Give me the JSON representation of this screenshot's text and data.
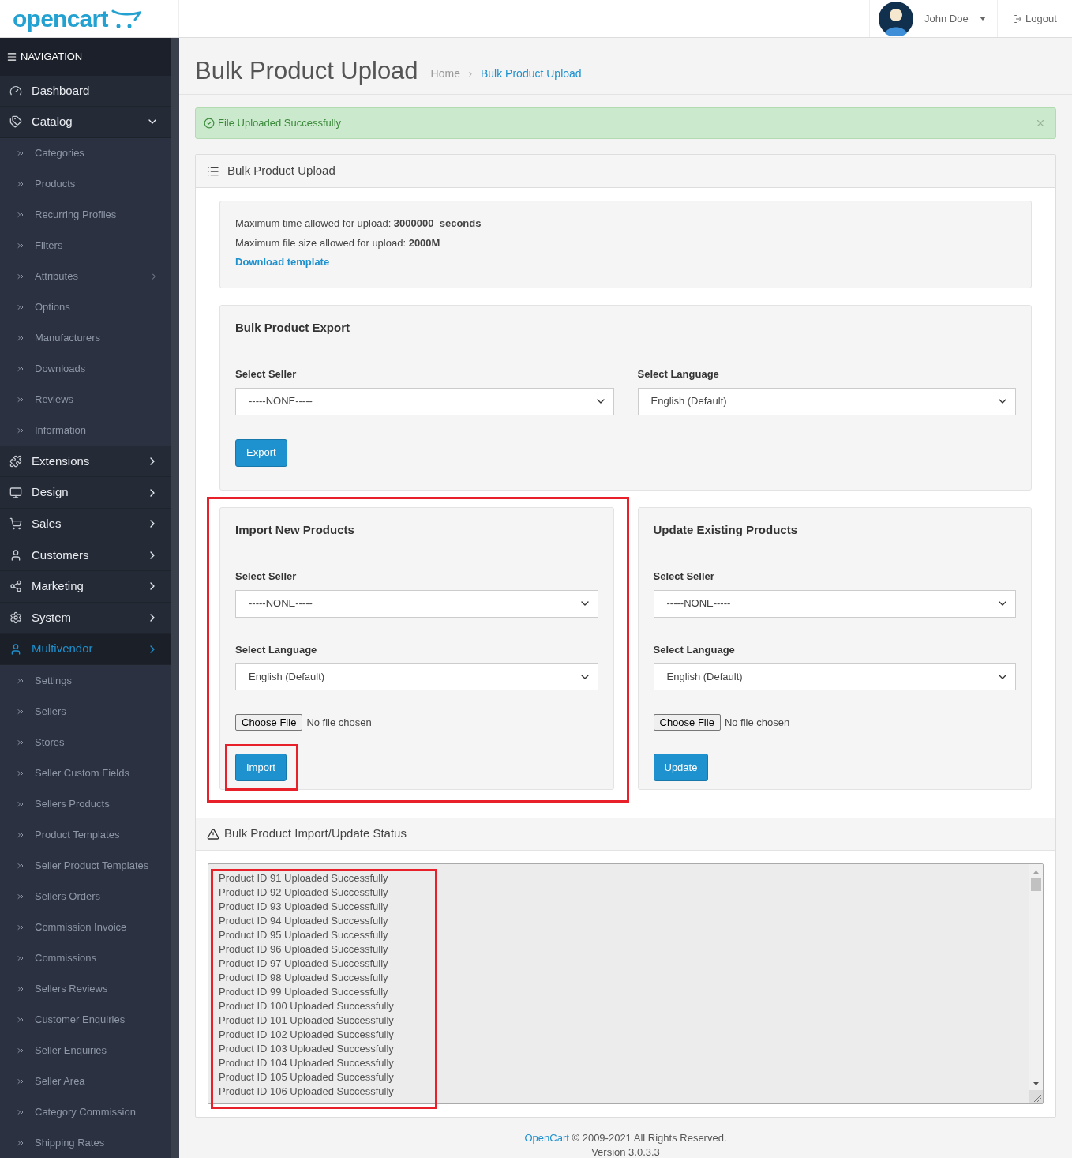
{
  "header": {
    "logo": "opencart",
    "user_name": "John Doe",
    "logout": "Logout"
  },
  "sidebar": {
    "title": "NAVIGATION",
    "items": [
      {
        "label": "Dashboard",
        "kind": "link",
        "selected": false
      },
      {
        "label": "Catalog",
        "kind": "menu_open",
        "selected": false,
        "expanded": true,
        "children": [
          {
            "label": "Categories",
            "kind": "link"
          },
          {
            "label": "Products",
            "kind": "link"
          },
          {
            "label": "Recurring Profiles",
            "kind": "link"
          },
          {
            "label": "Filters",
            "kind": "link"
          },
          {
            "label": "Attributes",
            "kind": "menu"
          },
          {
            "label": "Options",
            "kind": "link"
          },
          {
            "label": "Manufacturers",
            "kind": "link"
          },
          {
            "label": "Downloads",
            "kind": "link"
          },
          {
            "label": "Reviews",
            "kind": "link"
          },
          {
            "label": "Information",
            "kind": "link"
          }
        ]
      },
      {
        "label": "Extensions",
        "kind": "menu",
        "selected": false
      },
      {
        "label": "Design",
        "kind": "menu",
        "selected": false
      },
      {
        "label": "Sales",
        "kind": "menu",
        "selected": false
      },
      {
        "label": "Customers",
        "kind": "menu",
        "selected": false
      },
      {
        "label": "Marketing",
        "kind": "menu",
        "selected": false
      },
      {
        "label": "System",
        "kind": "menu",
        "selected": false
      },
      {
        "label": "Multivendor",
        "kind": "menu",
        "selected": true,
        "expanded": true,
        "children": [
          {
            "label": "Settings",
            "kind": "link"
          },
          {
            "label": "Sellers",
            "kind": "link"
          },
          {
            "label": "Stores",
            "kind": "link"
          },
          {
            "label": "Seller Custom Fields",
            "kind": "link"
          },
          {
            "label": "Sellers Products",
            "kind": "link"
          },
          {
            "label": "Product Templates",
            "kind": "link"
          },
          {
            "label": "Seller Product Templates",
            "kind": "link"
          },
          {
            "label": "Sellers Orders",
            "kind": "link"
          },
          {
            "label": "Commission Invoice",
            "kind": "link"
          },
          {
            "label": "Commissions",
            "kind": "link"
          },
          {
            "label": "Sellers Reviews",
            "kind": "link"
          },
          {
            "label": "Customer Enquiries",
            "kind": "link"
          },
          {
            "label": "Seller Enquiries",
            "kind": "link"
          },
          {
            "label": "Seller Area",
            "kind": "link"
          },
          {
            "label": "Category Commission",
            "kind": "link"
          },
          {
            "label": "Shipping Rates",
            "kind": "link"
          }
        ]
      }
    ]
  },
  "page": {
    "title": "Bulk Product Upload",
    "breadcrumbs": [
      "Home",
      "Bulk Product Upload"
    ]
  },
  "alert": {
    "text": "File Uploaded Successfully"
  },
  "panel": {
    "title": "Bulk Product Upload",
    "info": {
      "lines": [
        "Maximum time allowed for upload: **3000000  seconds**",
        "Maximum file size allowed for upload: **2000M**"
      ],
      "link": "Download template"
    },
    "export": {
      "title": "Bulk Product Export",
      "fields": [
        {
          "label": "Select Seller",
          "value": "-----NONE-----"
        },
        {
          "label": "Select Language",
          "value": "English (Default)"
        }
      ],
      "button": "Export"
    },
    "forms": [
      {
        "title": "Import New Products",
        "fields": [
          {
            "label": "Select Seller",
            "value": "-----NONE-----"
          },
          {
            "label": "Select Language",
            "value": "English (Default)"
          }
        ],
        "file_button": "Choose File",
        "file_status": "No file chosen",
        "button": "Import",
        "highlighted": true,
        "button_highlighted": true
      },
      {
        "title": "Update Existing Products",
        "fields": [
          {
            "label": "Select Seller",
            "value": "-----NONE-----"
          },
          {
            "label": "Select Language",
            "value": "English (Default)"
          }
        ],
        "file_button": "Choose File",
        "file_status": "No file chosen",
        "button": "Update",
        "highlighted": false,
        "button_highlighted": false
      }
    ],
    "status": {
      "title": "Bulk Product Import/Update Status",
      "highlighted": true,
      "lines": [
        "Product ID 91 Uploaded Successfully",
        "Product ID 92 Uploaded Successfully",
        "Product ID 93 Uploaded Successfully",
        "Product ID 94 Uploaded Successfully",
        "Product ID 95 Uploaded Successfully",
        "Product ID 96 Uploaded Successfully",
        "Product ID 97 Uploaded Successfully",
        "Product ID 98 Uploaded Successfully",
        "Product ID 99 Uploaded Successfully",
        "Product ID 100 Uploaded Successfully",
        "Product ID 101 Uploaded Successfully",
        "Product ID 102 Uploaded Successfully",
        "Product ID 103 Uploaded Successfully",
        "Product ID 104 Uploaded Successfully",
        "Product ID 105 Uploaded Successfully",
        "Product ID 106 Uploaded Successfully"
      ]
    }
  },
  "footer": {
    "link": "OpenCart",
    "text": "© 2009-2021 All Rights Reserved.",
    "version": "Version 3.0.3.3"
  }
}
